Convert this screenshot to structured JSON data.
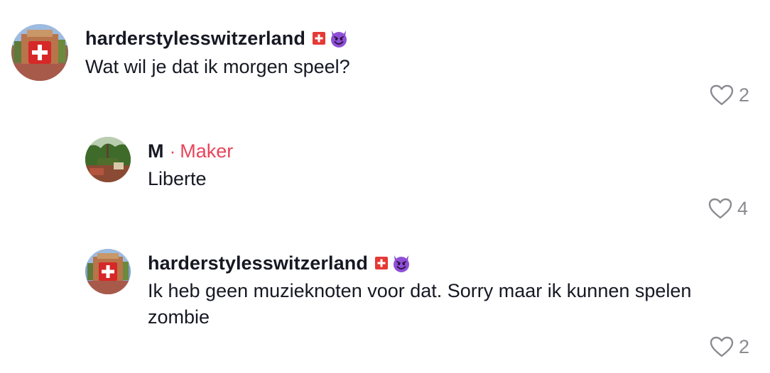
{
  "comments": [
    {
      "username": "harderstylesswitzerland",
      "text": "Wat wil je dat ik morgen speel?",
      "likes": "2",
      "badges": [
        "swiss-flag-icon",
        "smiling-devil-icon"
      ]
    },
    {
      "username": "M",
      "separator": "·",
      "role_label": "Maker",
      "text": "Liberte",
      "likes": "4"
    },
    {
      "username": "harderstylesswitzerland",
      "text": "Ik heb geen muzieknoten voor dat. Sorry maar ik kunnen spelen zombie",
      "likes": "2",
      "badges": [
        "swiss-flag-icon",
        "smiling-devil-icon"
      ]
    }
  ],
  "colors": {
    "text": "#161823",
    "maker_accent": "#e8445a",
    "muted": "#8a8b91"
  }
}
